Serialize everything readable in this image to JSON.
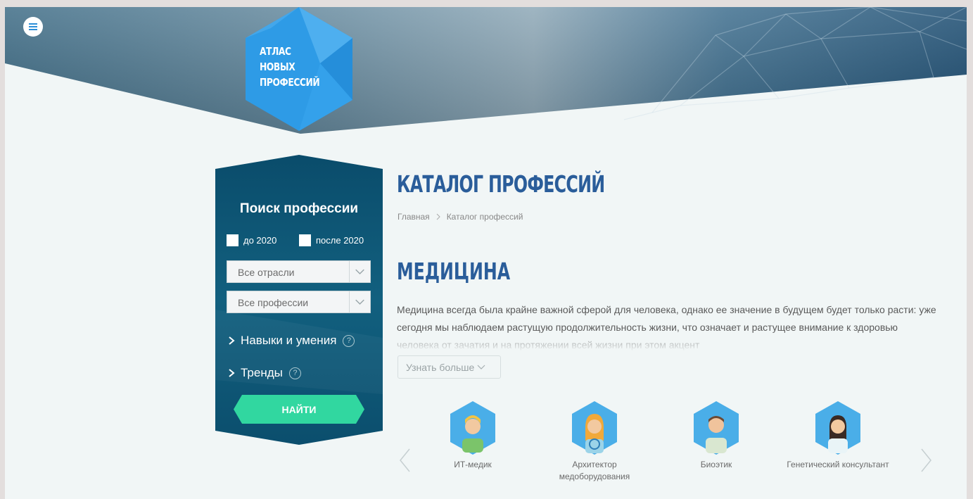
{
  "header": {
    "logo_lines": [
      "АТЛАС",
      "НОВЫХ",
      "ПРОФЕССИЙ"
    ],
    "menu_icon": "hamburger-icon"
  },
  "search": {
    "title": "Поиск профессии",
    "checkbox_before": "до 2020",
    "checkbox_after": "после 2020",
    "industry_select": "Все отрасли",
    "profession_select": "Все профессии",
    "skills_label": "Навыки и умения",
    "trends_label": "Тренды",
    "help_symbol": "?",
    "find_button": "НАЙТИ"
  },
  "main": {
    "page_title": "КАТАЛОГ ПРОФЕССИЙ",
    "breadcrumb": [
      "Главная",
      "Каталог профессий"
    ],
    "section_title": "МЕДИЦИНА",
    "description": "Медицина всегда была крайне важной сферой для человека, однако ее значение в будущем будет только расти: уже сегодня мы наблюдаем растущую продолжительность жизни, что означает и растущее внимание к здоровью человека от зачатия и на протяжении всей жизни при этом акцент",
    "more_button": "Узнать больше"
  },
  "professions": [
    {
      "name": "ИТ-медик"
    },
    {
      "name": "Архитектор медоборудования"
    },
    {
      "name": "Биоэтик"
    },
    {
      "name": "Генетический консультант"
    }
  ],
  "colors": {
    "accent_blue": "#2a5d9a",
    "logo_blue": "#2e9be6",
    "panel_teal": "#0d5271",
    "button_green": "#31d7a0"
  }
}
